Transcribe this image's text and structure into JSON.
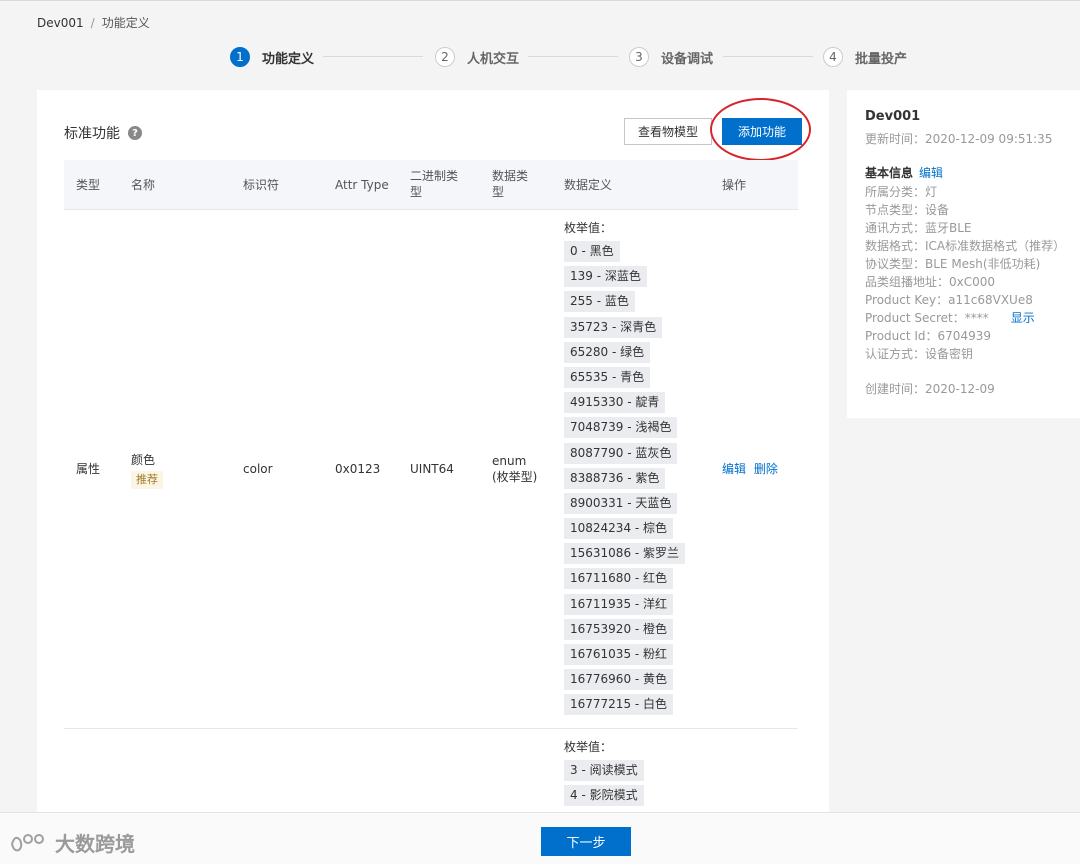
{
  "breadcrumb": {
    "root": "Dev001",
    "separator": "/",
    "current": "功能定义"
  },
  "steps": [
    {
      "num": "1",
      "label": "功能定义"
    },
    {
      "num": "2",
      "label": "人机交互"
    },
    {
      "num": "3",
      "label": "设备调试"
    },
    {
      "num": "4",
      "label": "批量投产"
    }
  ],
  "main": {
    "title": "标准功能",
    "help_icon": "?",
    "view_model_button": "查看物模型",
    "add_function_button": "添加功能"
  },
  "table": {
    "headers": {
      "type": "类型",
      "name": "名称",
      "identifier": "标识符",
      "attr_type": "Attr Type",
      "binary_type_l1": "二进制类",
      "binary_type_l2": "型",
      "data_type_l1": "数据类",
      "data_type_l2": "型",
      "data_def": "数据定义",
      "action": "操作"
    },
    "row1": {
      "type": "属性",
      "name": "颜色",
      "tag": "推荐",
      "identifier": "color",
      "attr_type": "0x0123",
      "binary_type": "UINT64",
      "data_type_l1": "enum",
      "data_type_l2": "(枚举型)",
      "enum_title": "枚举值：",
      "enums": [
        "0 - 黑色",
        "139 - 深蓝色",
        "255 - 蓝色",
        "35723 - 深青色",
        "65280 - 绿色",
        "65535 - 青色",
        "4915330 - 靛青",
        "7048739 - 浅褐色",
        "8087790 - 蓝灰色",
        "8388736 - 紫色",
        "8900331 - 天蓝色",
        "10824234 - 棕色",
        "15631086 - 紫罗兰",
        "16711680 - 红色",
        "16711935 - 洋红",
        "16753920 - 橙色",
        "16761035 - 粉红",
        "16776960 - 黄色",
        "16777215 - 白色"
      ],
      "edit": "编辑",
      "delete": "删除"
    },
    "row2": {
      "enum_title": "枚举值：",
      "enums": [
        "3 - 阅读模式",
        "4 - 影院模式"
      ]
    }
  },
  "side": {
    "device_name": "Dev001",
    "updated": "更新时间：2020-12-09 09:51:35",
    "basic_info": "基本信息",
    "edit": "编辑",
    "info": [
      "所属分类：灯",
      "节点类型：设备",
      "通讯方式：蓝牙BLE",
      "数据格式：ICA标准数据格式（推荐）",
      "协议类型：BLE Mesh(非低功耗)",
      "品类组播地址：0xC000"
    ],
    "product_key": "Product Key：a11c68VXUe8",
    "product_secret": "Product Secret：****",
    "show": "显示",
    "product_id": "Product Id：6704939",
    "auth": "认证方式：设备密钥",
    "created": "创建时间：2020-12-09"
  },
  "footer": {
    "next_button": "下一步",
    "watermark": "大数跨境"
  },
  "colors": {
    "primary": "#0070cc",
    "highlight_circle": "#d8232a",
    "tag_bg": "#fdf5e4"
  }
}
